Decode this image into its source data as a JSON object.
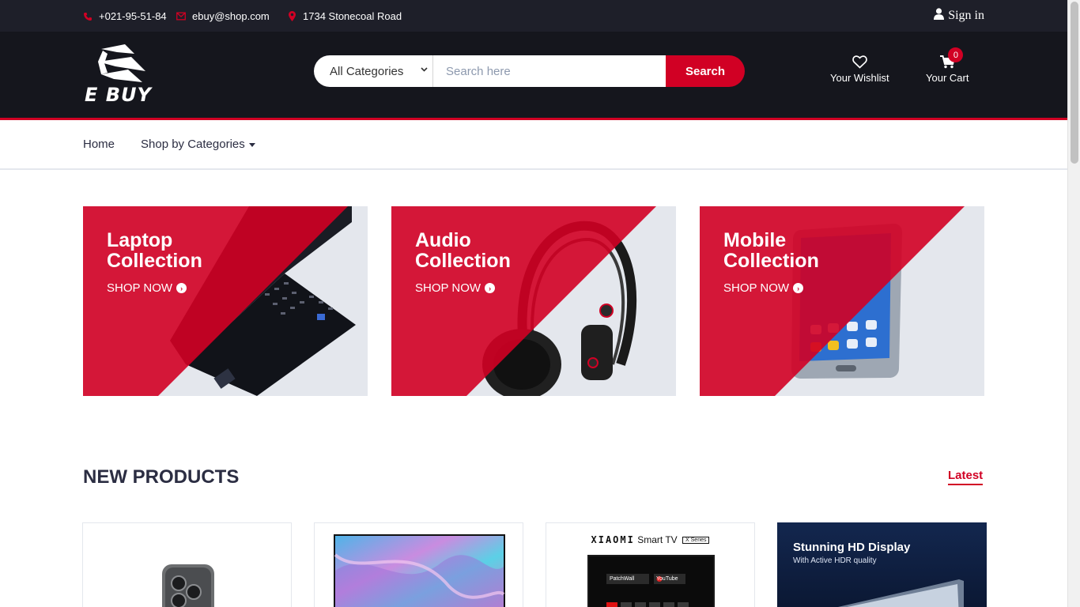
{
  "topbar": {
    "phone": "+021-95-51-84",
    "email": "ebuy@shop.com",
    "address": "1734 Stonecoal Road",
    "signin": "Sign in",
    "icons": {
      "phone": "phone-icon",
      "email": "envelope-icon",
      "address": "map-marker-icon",
      "user": "user-icon"
    }
  },
  "header": {
    "logo_text": "E BUY",
    "search": {
      "category": "All Categories",
      "placeholder": "Search here",
      "button": "Search"
    },
    "wishlist_label": "Your Wishlist",
    "cart_label": "Your Cart",
    "cart_count": "0"
  },
  "nav": {
    "home": "Home",
    "categories": "Shop by Categories"
  },
  "collections": [
    {
      "title_line1": "Laptop",
      "title_line2": "Collection",
      "cta": "SHOP NOW"
    },
    {
      "title_line1": "Audio",
      "title_line2": "Collection",
      "cta": "SHOP NOW"
    },
    {
      "title_line1": "Mobile",
      "title_line2": "Collection",
      "cta": "SHOP NOW"
    }
  ],
  "new_products": {
    "title": "NEW PRODUCTS",
    "tab": "Latest",
    "products": [
      {
        "image": "smartphone"
      },
      {
        "image": "television-abstract"
      },
      {
        "image": "xiaomi-smart-tv",
        "brand": "XIAOMI",
        "title": "Smart TV",
        "badge": "X Series",
        "apps": [
          "PatchWall",
          "YouTube"
        ]
      },
      {
        "image": "hd-display",
        "title": "Stunning HD Display",
        "subtitle": "With Active HDR quality"
      }
    ]
  },
  "colors": {
    "accent": "#d10024",
    "topbar": "#1e1f29",
    "header": "#15161d",
    "text": "#2b2d42"
  }
}
